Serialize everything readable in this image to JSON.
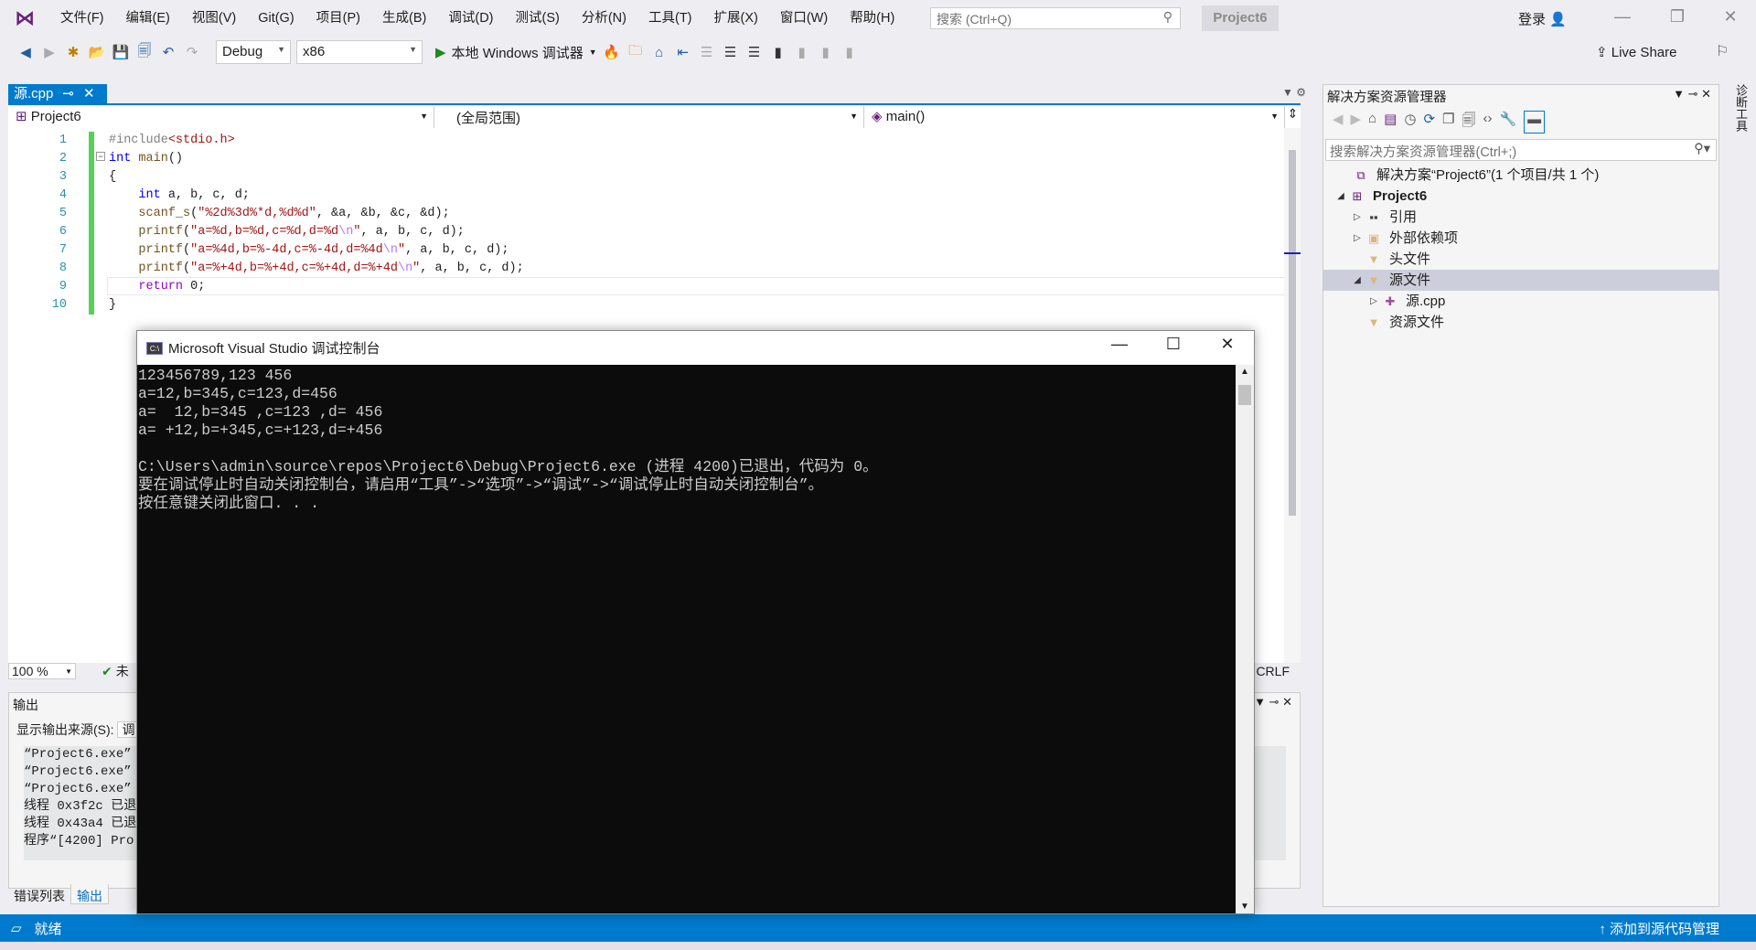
{
  "menu": [
    "文件(F)",
    "编辑(E)",
    "视图(V)",
    "Git(G)",
    "项目(P)",
    "生成(B)",
    "调试(D)",
    "测试(S)",
    "分析(N)",
    "工具(T)",
    "扩展(X)",
    "窗口(W)",
    "帮助(H)"
  ],
  "search_placeholder": "搜索 (Ctrl+Q)",
  "project_badge": "Project6",
  "login": "登录",
  "toolbar": {
    "config": "Debug",
    "platform": "x86",
    "run": "本地 Windows 调试器",
    "live_share": "Live Share"
  },
  "editor": {
    "tab": "源.cpp",
    "nav": {
      "project": "Project6",
      "scope": "(全局范围)",
      "member": "main()"
    },
    "lines": [
      "1",
      "2",
      "3",
      "4",
      "5",
      "6",
      "7",
      "8",
      "9",
      "10"
    ],
    "code": [
      "#include<stdio.h>",
      "int main()",
      "{",
      "    int a, b, c, d;",
      "    scanf_s(\"%2d%3d%*d,%d%d\", &a, &b, &c, &d);",
      "    printf(\"a=%d,b=%d,c=%d,d=%d\\n\", a, b, c, d);",
      "    printf(\"a=%4d,b=%-4d,c=%-4d,d=%4d\\n\", a, b, c, d);",
      "    printf(\"a=%+4d,b=%+4d,c=%+4d,d=%+4d\\n\", a, b, c, d);",
      "    return 0;",
      "}"
    ],
    "zoom": "100 %",
    "status": "未",
    "line_ending": "CRLF"
  },
  "output": {
    "title": "输出",
    "source_label": "显示输出来源(S):",
    "source_value": "调",
    "lines": [
      "“Project6.exe”",
      "“Project6.exe”",
      "“Project6.exe”",
      "线程 0x3f2c 已退",
      "线程 0x43a4 已退",
      "程序“[4200] Pro"
    ],
    "tabs": [
      "错误列表",
      "输出"
    ]
  },
  "solution_explorer": {
    "title": "解决方案资源管理器",
    "search_placeholder": "搜索解决方案资源管理器(Ctrl+;)",
    "nodes": [
      {
        "label": "解决方案“Project6”(1 个项目/共 1 个)"
      },
      {
        "label": "Project6"
      },
      {
        "label": "引用"
      },
      {
        "label": "外部依赖项"
      },
      {
        "label": "头文件"
      },
      {
        "label": "源文件"
      },
      {
        "label": "源.cpp"
      },
      {
        "label": "资源文件"
      }
    ],
    "side_tab": "诊断工具"
  },
  "console": {
    "title": "Microsoft Visual Studio 调试控制台",
    "icon_text": "C:\\",
    "lines": [
      "123456789,123 456",
      "a=12,b=345,c=123,d=456",
      "a=  12,b=345 ,c=123 ,d= 456",
      "a= +12,b=+345,c=+123,d=+456",
      "",
      "C:\\Users\\admin\\source\\repos\\Project6\\Debug\\Project6.exe (进程 4200)已退出，代码为 0。",
      "要在调试停止时自动关闭控制台，请启用“工具”->“选项”->“调试”->“调试停止时自动关闭控制台”。",
      "按任意键关闭此窗口. . ."
    ]
  },
  "statusbar": {
    "text": "就绪",
    "right": "添加到源代码管理"
  },
  "colors": {
    "accent": "#007acc",
    "console_bg": "#0c0c0c"
  }
}
